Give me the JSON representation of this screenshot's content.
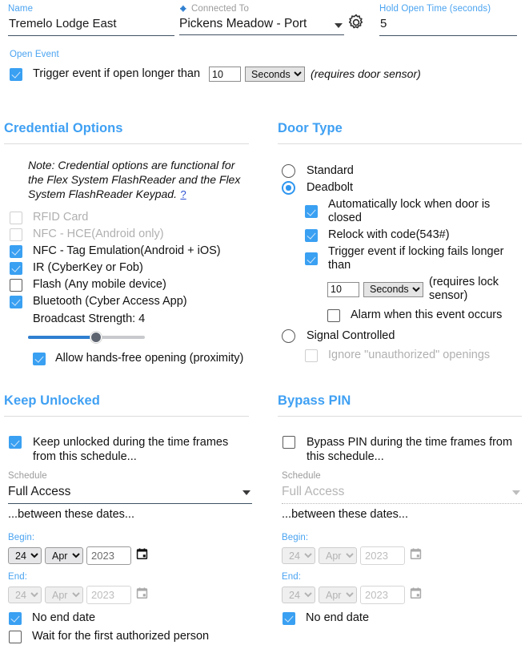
{
  "header": {
    "name": {
      "label": "Name",
      "value": "Tremelo Lodge East"
    },
    "connected_to": {
      "label": "Connected To",
      "icon": "puzzle-piece-icon",
      "value": "Pickens Meadow - Port",
      "settings_icon": "gear-icon"
    },
    "hold_open_time": {
      "label": "Hold Open Time (seconds)",
      "value": "5"
    }
  },
  "open_event": {
    "label": "Open Event",
    "trigger": {
      "checked": true,
      "label": "Trigger event if open longer than",
      "value": "10",
      "unit": "Seconds",
      "note": "(requires door sensor)"
    }
  },
  "credential_options": {
    "title": "Credential Options",
    "note": "Note: Credential options are functional for the Flex System FlashReader and the Flex System FlashReader Keypad.",
    "help": "?",
    "items": [
      {
        "label": "RFID Card",
        "checked": false,
        "disabled": true
      },
      {
        "label": "NFC - HCE(Android only)",
        "checked": false,
        "disabled": true
      },
      {
        "label": "NFC - Tag Emulation(Android + iOS)",
        "checked": true,
        "disabled": false
      },
      {
        "label": "IR (CyberKey or Fob)",
        "checked": true,
        "disabled": false
      },
      {
        "label": "Flash (Any mobile device)",
        "checked": false,
        "disabled": false
      },
      {
        "label": "Bluetooth (Cyber Access App)",
        "checked": true,
        "disabled": false
      }
    ],
    "broadcast": {
      "label": "Broadcast Strength: 4",
      "value": 4,
      "min": 1,
      "max": 7,
      "percent": 58
    },
    "hands_free": {
      "label": "Allow hands-free opening (proximity)",
      "checked": true
    }
  },
  "door_type": {
    "title": "Door Type",
    "options": [
      {
        "label": "Standard",
        "selected": false
      },
      {
        "label": "Deadbolt",
        "selected": true
      },
      {
        "label": "Signal Controlled",
        "selected": false
      }
    ],
    "deadbolt_sub": [
      {
        "label": "Automatically lock when door is closed",
        "checked": true
      },
      {
        "label": "Relock with code(543#)",
        "checked": true
      },
      {
        "label": "Trigger event if locking fails longer than",
        "checked": true
      }
    ],
    "lock_fail": {
      "value": "10",
      "unit": "Seconds",
      "note": "(requires lock sensor)"
    },
    "alarm": {
      "label": "Alarm when this event occurs",
      "checked": false
    },
    "signal_sub": {
      "label": "Ignore \"unauthorized\" openings",
      "checked": false,
      "disabled": true
    }
  },
  "keep_unlocked": {
    "title": "Keep Unlocked",
    "enable": {
      "label": "Keep unlocked during the time frames from this schedule...",
      "checked": true
    },
    "schedule": {
      "label": "Schedule",
      "value": "Full Access",
      "disabled": false
    },
    "between": "...between these dates...",
    "begin": {
      "label": "Begin:",
      "day": "24",
      "month": "Apr",
      "year": "2023",
      "disabled": false
    },
    "end": {
      "label": "End:",
      "day": "24",
      "month": "Apr",
      "year": "2023",
      "disabled": true
    },
    "no_end_date": {
      "label": "No end date",
      "checked": true
    },
    "wait_first": {
      "label": "Wait for the first authorized person",
      "checked": false
    }
  },
  "bypass_pin": {
    "title": "Bypass PIN",
    "enable": {
      "label": "Bypass PIN during the time frames from this schedule...",
      "checked": false
    },
    "schedule": {
      "label": "Schedule",
      "value": "Full Access",
      "disabled": true
    },
    "between": "...between these dates...",
    "begin": {
      "label": "Begin:",
      "day": "24",
      "month": "Apr",
      "year": "2023",
      "disabled": true
    },
    "end": {
      "label": "End:",
      "day": "24",
      "month": "Apr",
      "year": "2023",
      "disabled": true
    },
    "no_end_date": {
      "label": "No end date",
      "checked": true
    }
  },
  "colors": {
    "accent": "#3fa0f3",
    "label_blue": "#4aa3f0",
    "checkbox_blue": "#3aa0f2",
    "slider_fill": "#2f7fd0"
  }
}
